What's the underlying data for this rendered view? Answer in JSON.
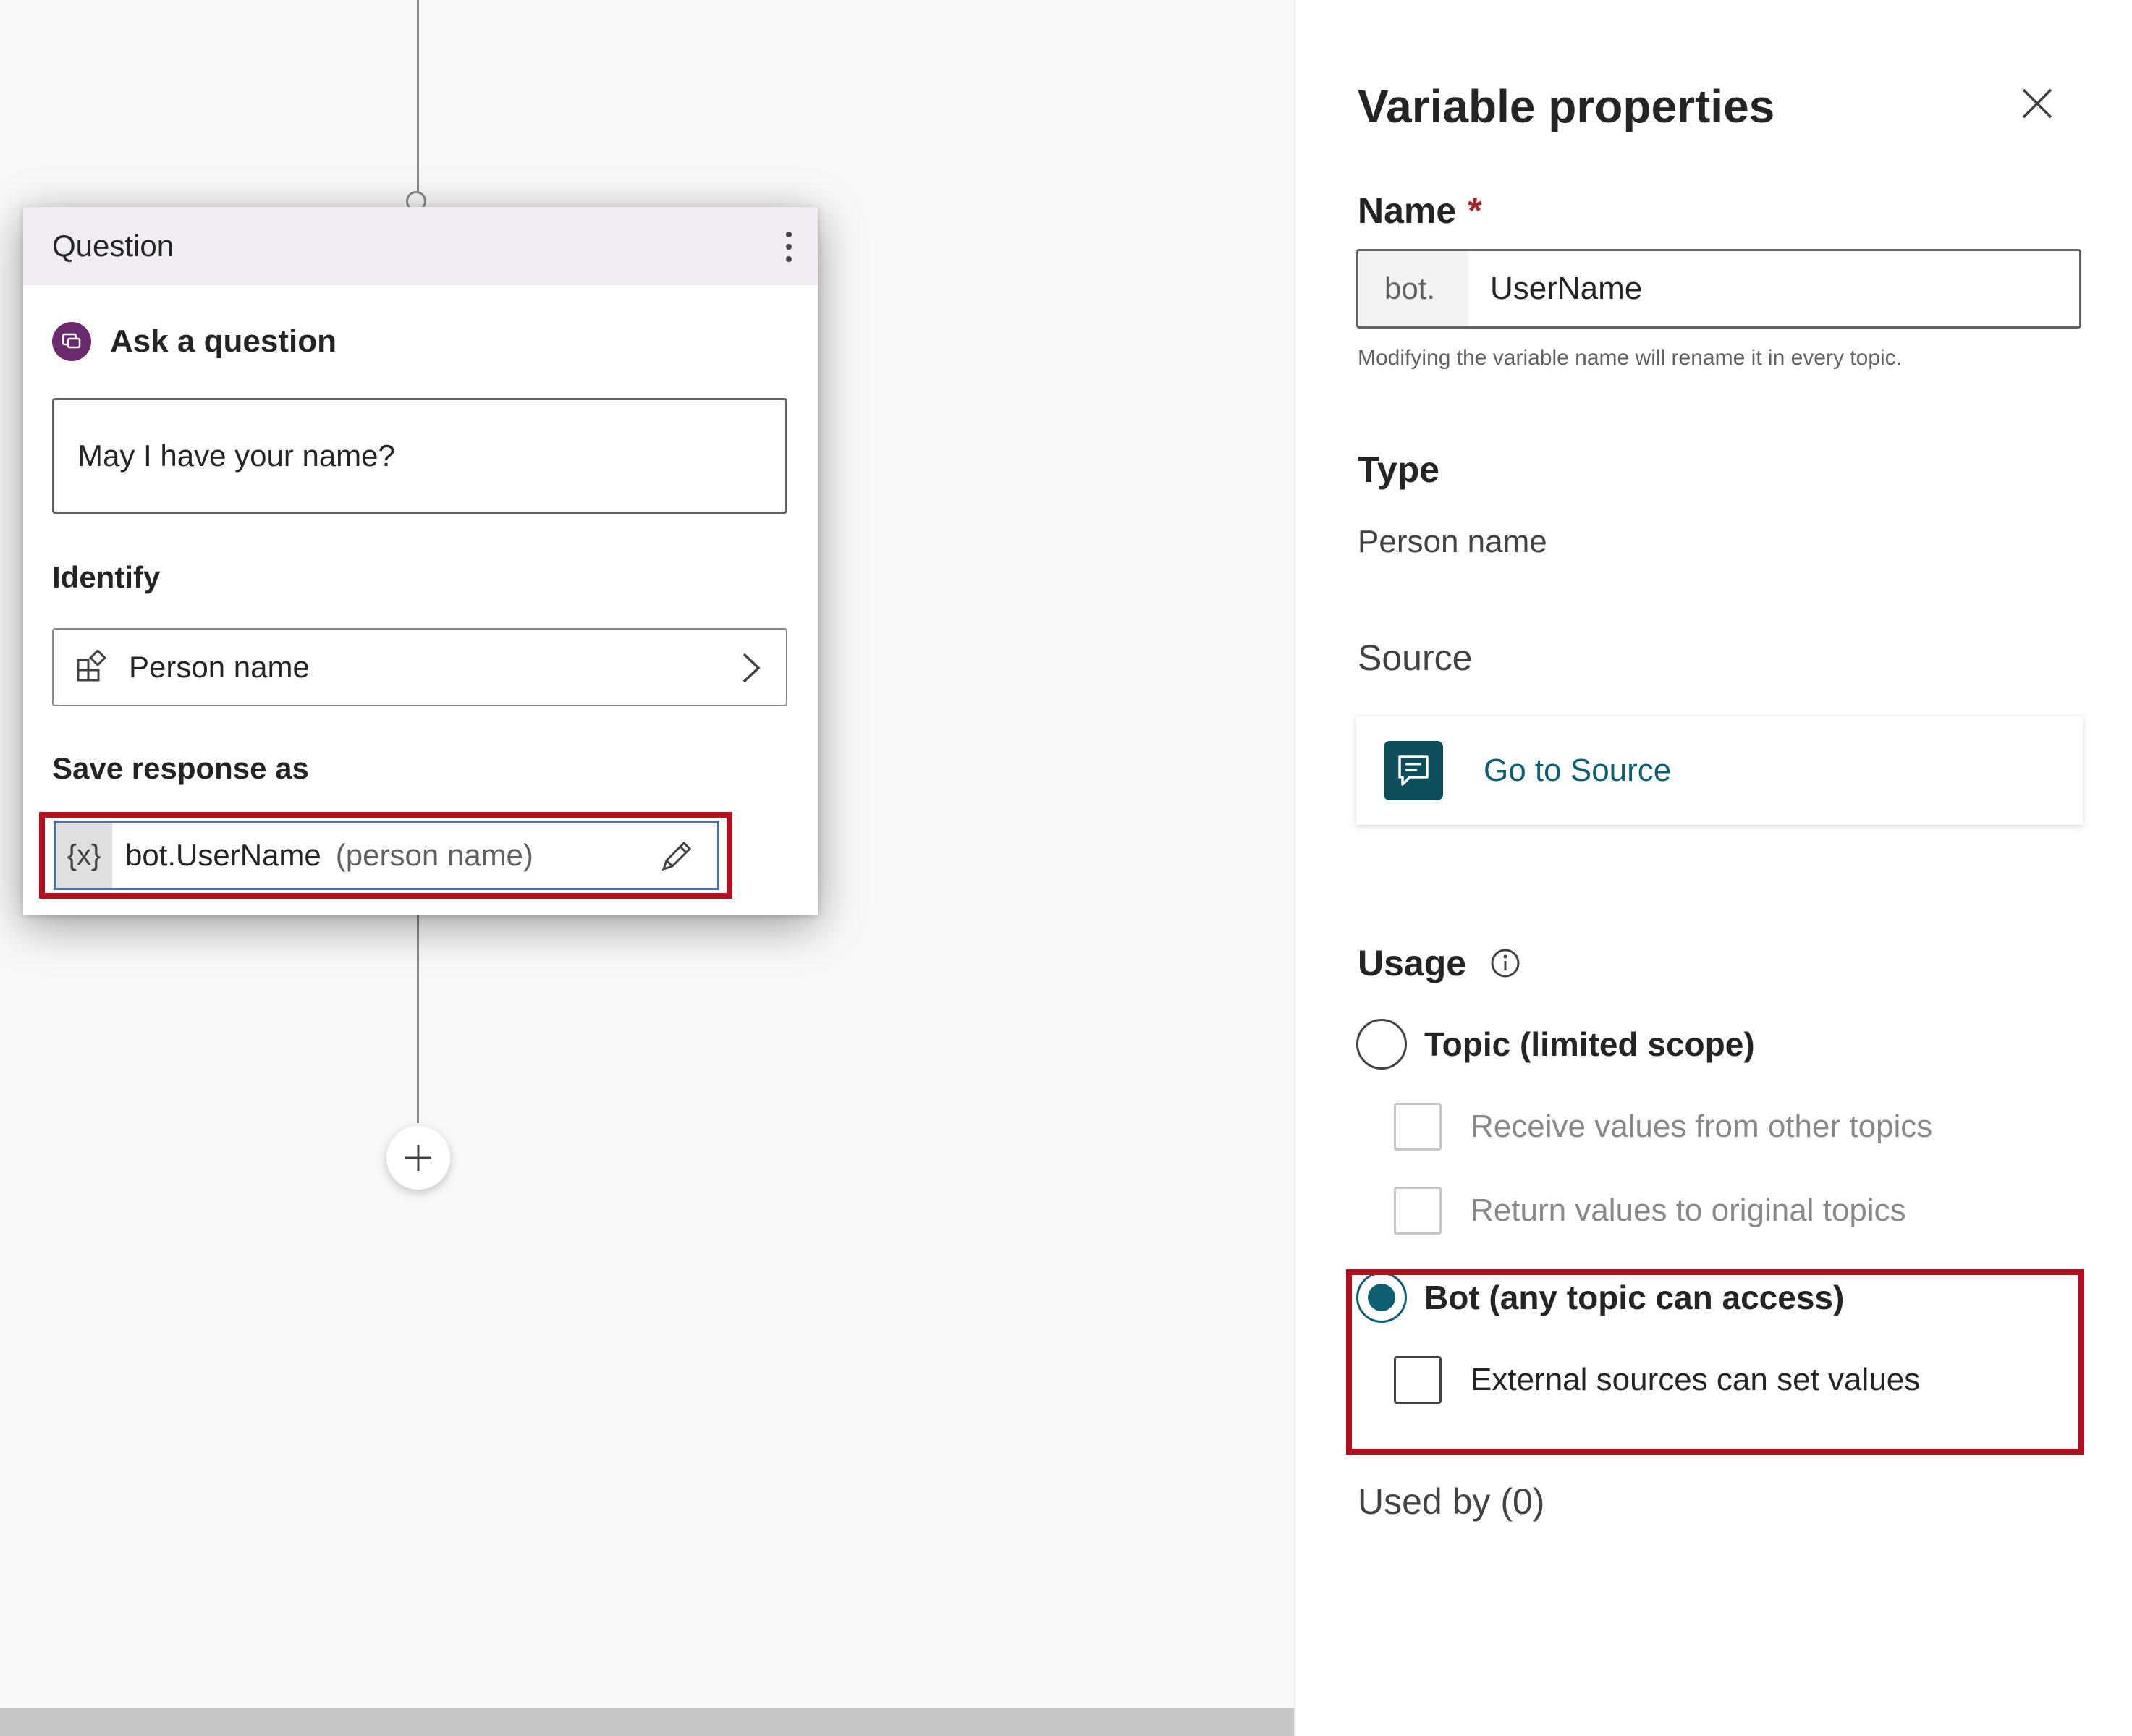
{
  "canvas": {
    "question_card": {
      "title": "Question",
      "ask_label": "Ask a question",
      "question_text": "May I have your name?",
      "identify_label": "Identify",
      "identify_value": "Person name",
      "save_label": "Save response as",
      "variable_icon_text": "{x}",
      "variable_name": "bot.UserName",
      "variable_type": "(person name)"
    }
  },
  "panel": {
    "title": "Variable properties",
    "name_label": "Name",
    "required_mark": "*",
    "name_prefix": "bot.",
    "name_value": "UserName",
    "name_hint": "Modifying the variable name will rename it in every topic.",
    "type_label": "Type",
    "type_value": "Person name",
    "source_label": "Source",
    "go_to_source": "Go to Source",
    "usage_label": "Usage",
    "usage_options": [
      {
        "label": "Topic (limited scope)",
        "selected": false
      },
      {
        "label": "Bot (any topic can access)",
        "selected": true
      }
    ],
    "topic_checkboxes": [
      {
        "label": "Receive values from other topics",
        "checked": false,
        "disabled": true
      },
      {
        "label": "Return values to original topics",
        "checked": false,
        "disabled": true
      }
    ],
    "bot_checkbox": {
      "label": "External sources can set values",
      "checked": false
    },
    "used_by": "Used by (0)"
  },
  "colors": {
    "accent": "#0f5f73",
    "highlight": "#b40f1e",
    "card_header": "#f1ecf4",
    "message_icon": "#6b2a6e"
  },
  "icons": [
    "more-options-icon",
    "message-icon",
    "entity-icon",
    "chevron-right-icon",
    "pencil-icon",
    "close-icon",
    "chat-icon",
    "info-icon",
    "plus-icon"
  ]
}
